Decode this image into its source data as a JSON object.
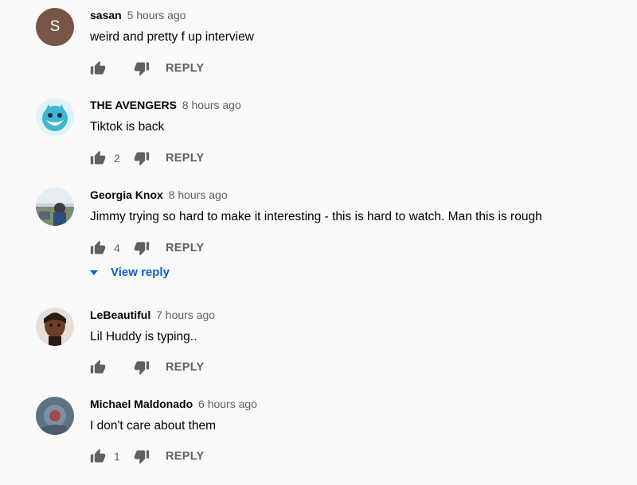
{
  "reply_label": "REPLY",
  "colors": {
    "author": "#030303",
    "timestamp": "#606060",
    "link_blue": "#065fd4",
    "avatar_letter_bg": "#795548"
  },
  "icons": {
    "like": "thumb-up-icon",
    "dislike": "thumb-down-icon",
    "expand": "caret-down-icon"
  },
  "comments": [
    {
      "author": "sasan",
      "time": "5 hours ago",
      "text": "weird and pretty f up interview",
      "likes": "",
      "avatar_letter": "S"
    },
    {
      "author": "THE AVENGERS",
      "time": "8 hours ago",
      "text": "Tiktok is back",
      "likes": "2"
    },
    {
      "author": "Georgia Knox",
      "time": "8 hours ago",
      "text": "Jimmy trying so hard to make it interesting - this is hard to watch.  Man this is rough",
      "likes": "4",
      "view_replies_label": "View reply"
    },
    {
      "author": "LeBeautiful",
      "time": "7 hours ago",
      "text": "Lil Huddy is typing..",
      "likes": ""
    },
    {
      "author": "Michael Maldonado",
      "time": "6 hours ago",
      "text": "I don't care about them",
      "likes": "1"
    }
  ]
}
